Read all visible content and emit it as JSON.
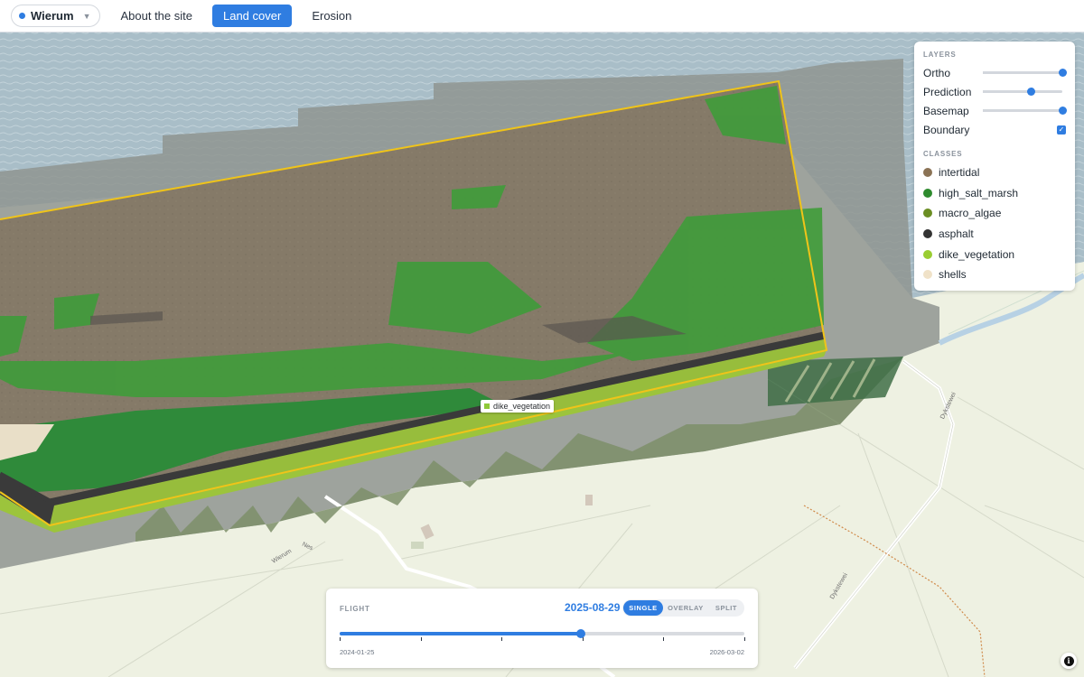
{
  "topbar": {
    "site": "Wierum",
    "tabs": [
      "About the site",
      "Land cover",
      "Erosion"
    ],
    "active_tab": "Land cover"
  },
  "map": {
    "hover_label": "dike_vegetation",
    "road_labels": [
      "Wierum",
      "Nes",
      "Dykstewei",
      "Dykstewei"
    ]
  },
  "layers_panel": {
    "heading": "LAYERS",
    "layers": [
      {
        "name": "Ortho",
        "opacity": 1.0
      },
      {
        "name": "Prediction",
        "opacity": 0.6
      },
      {
        "name": "Basemap",
        "opacity": 1.0
      }
    ],
    "boundary": {
      "name": "Boundary",
      "checked": true
    },
    "classes_heading": "CLASSES",
    "classes": [
      {
        "name": "intertidal",
        "color": "#8b7355"
      },
      {
        "name": "high_salt_marsh",
        "color": "#2e8b2e"
      },
      {
        "name": "macro_algae",
        "color": "#6b8e23"
      },
      {
        "name": "asphalt",
        "color": "#333333"
      },
      {
        "name": "dike_vegetation",
        "color": "#9acd32"
      },
      {
        "name": "shells",
        "color": "#f0e2c8"
      }
    ]
  },
  "timeline": {
    "label": "FLIGHT",
    "selected_date": "2025-08-29",
    "modes": [
      "SINGLE",
      "OVERLAY",
      "SPLIT"
    ],
    "active_mode": "SINGLE",
    "start_date": "2024-01-25",
    "end_date": "2026-03-02",
    "position": 0.596,
    "flight_count": 6
  },
  "colors": {
    "accent": "#2f7de1",
    "boundary": "#f0c419",
    "water": "#a7bcc6"
  },
  "info_icon": "info-icon"
}
